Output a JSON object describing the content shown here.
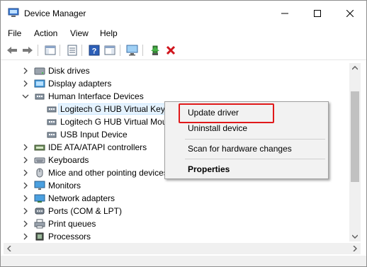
{
  "window": {
    "title": "Device Manager"
  },
  "menu": [
    "File",
    "Action",
    "View",
    "Help"
  ],
  "tree": {
    "items": [
      {
        "label": "Disk drives",
        "icon": "disk-drive-icon",
        "expander": "collapsed",
        "indent": 0
      },
      {
        "label": "Display adapters",
        "icon": "display-adapter-icon",
        "expander": "collapsed",
        "indent": 0
      },
      {
        "label": "Human Interface Devices",
        "icon": "hid-icon",
        "expander": "expanded",
        "indent": 0
      },
      {
        "label": "Logitech G HUB Virtual Keyboard",
        "icon": "hid-icon",
        "expander": "none",
        "indent": 1,
        "selected": true
      },
      {
        "label": "Logitech G HUB Virtual Mouse",
        "icon": "hid-icon",
        "expander": "none",
        "indent": 1
      },
      {
        "label": "USB Input Device",
        "icon": "hid-icon",
        "expander": "none",
        "indent": 1
      },
      {
        "label": "IDE ATA/ATAPI controllers",
        "icon": "ide-controller-icon",
        "expander": "collapsed",
        "indent": 0
      },
      {
        "label": "Keyboards",
        "icon": "keyboard-icon",
        "expander": "collapsed",
        "indent": 0
      },
      {
        "label": "Mice and other pointing devices",
        "icon": "mouse-icon",
        "expander": "collapsed",
        "indent": 0
      },
      {
        "label": "Monitors",
        "icon": "monitor-icon",
        "expander": "collapsed",
        "indent": 0
      },
      {
        "label": "Network adapters",
        "icon": "network-adapter-icon",
        "expander": "collapsed",
        "indent": 0
      },
      {
        "label": "Ports (COM & LPT)",
        "icon": "port-icon",
        "expander": "collapsed",
        "indent": 0
      },
      {
        "label": "Print queues",
        "icon": "printer-icon",
        "expander": "collapsed",
        "indent": 0
      },
      {
        "label": "Processors",
        "icon": "processor-icon",
        "expander": "collapsed",
        "indent": 0
      },
      {
        "label": "",
        "icon": "security-device-icon",
        "expander": "collapsed",
        "indent": 0
      }
    ]
  },
  "context_menu": {
    "items": [
      "Update driver",
      "Uninstall device",
      "Scan for hardware changes",
      "Properties"
    ],
    "highlighted": "Update driver",
    "highlight_color": "#e0191a"
  },
  "colors": {
    "accent": "#e0191a",
    "selection": "#e5f3ff"
  }
}
